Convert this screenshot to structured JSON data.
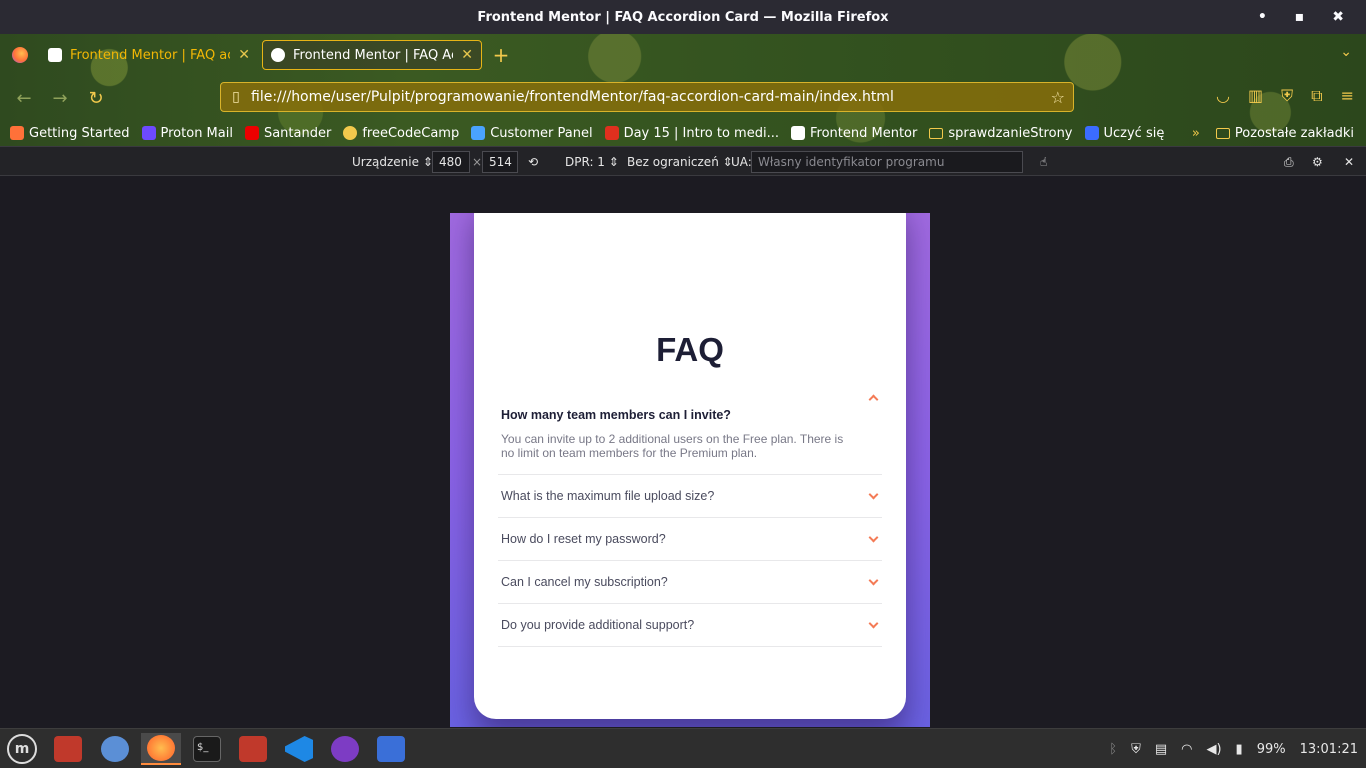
{
  "window": {
    "title": "Frontend Mentor | FAQ Accordion Card — Mozilla Firefox",
    "controls": [
      "minimize",
      "maximize",
      "close"
    ]
  },
  "tabs": [
    {
      "label": "Frontend Mentor | FAQ acc",
      "active": false
    },
    {
      "label": "Frontend Mentor | FAQ Acc",
      "active": true
    }
  ],
  "navbar": {
    "url": "file:///home/user/Pulpit/programowanie/frontendMentor/faq-accordion-card-main/index.html"
  },
  "bookmarks": [
    {
      "label": "Getting Started",
      "icon": "firefox-icon",
      "color": "#ff7139"
    },
    {
      "label": "Proton Mail",
      "icon": "protonmail-icon",
      "color": "#6d4aff"
    },
    {
      "label": "Santander",
      "icon": "santander-icon",
      "color": "#ec0000"
    },
    {
      "label": "freeCodeCamp",
      "icon": "globe-icon",
      "color": "#f2c94c"
    },
    {
      "label": "Customer Panel",
      "icon": "feather-icon",
      "color": "#4aa3ff"
    },
    {
      "label": "Day 15 | Intro to medi...",
      "icon": "kp-icon",
      "color": "#e0301e"
    },
    {
      "label": "Frontend Mentor",
      "icon": "page-icon",
      "color": "#ffffff"
    },
    {
      "label": "sprawdzanieStrony",
      "icon": "folder-icon",
      "color": "#f2c94c"
    },
    {
      "label": "Uczyć się",
      "icon": "learn-icon",
      "color": "#3b6cff"
    }
  ],
  "bookmarks_other": "Pozostałe zakładki",
  "rdm": {
    "device_label": "Urządzenie",
    "width": "480",
    "height": "514",
    "dpr": "DPR: 1",
    "throttle": "Bez ograniczeń",
    "ua_label": "UA:",
    "ua_placeholder": "Własny identyfikator programu"
  },
  "faq": {
    "title": "FAQ",
    "items": [
      {
        "question": "How many team members can I invite?",
        "answer": "You can invite up to 2 additional users on the Free plan. There is no limit on team members for the Premium plan.",
        "open": true
      },
      {
        "question": "What is the maximum file upload size?",
        "open": false
      },
      {
        "question": "How do I reset my password?",
        "open": false
      },
      {
        "question": "Can I cancel my subscription?",
        "open": false
      },
      {
        "question": "Do you provide additional support?",
        "open": false
      }
    ],
    "accent_color": "#f47b56"
  },
  "taskbar": {
    "battery": "99%",
    "time": "13:01:21"
  }
}
